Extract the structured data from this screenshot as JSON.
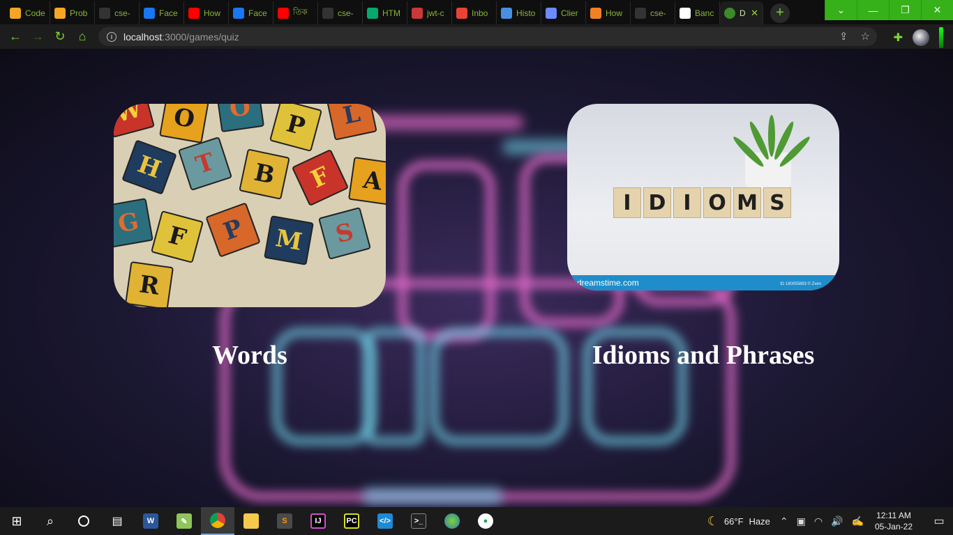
{
  "browser": {
    "tabs": [
      {
        "label": "Code",
        "icon": "bar-chart-icon",
        "color": "#f5a623"
      },
      {
        "label": "Prob",
        "icon": "bar-chart-icon",
        "color": "#f5a623"
      },
      {
        "label": "cse-",
        "icon": "github-icon",
        "color": "#333333"
      },
      {
        "label": "Face",
        "icon": "facebook-icon",
        "color": "#1877f2"
      },
      {
        "label": "How",
        "icon": "youtube-icon",
        "color": "#ff0000"
      },
      {
        "label": "Face",
        "icon": "facebook-icon",
        "color": "#1877f2"
      },
      {
        "label": "তিক",
        "icon": "youtube-icon",
        "color": "#ff0000"
      },
      {
        "label": "cse-",
        "icon": "github-icon",
        "color": "#333333"
      },
      {
        "label": "HTM",
        "icon": "w3-icon",
        "color": "#04aa6d"
      },
      {
        "label": "jwt-c",
        "icon": "npm-icon",
        "color": "#cb3837"
      },
      {
        "label": "Inbo",
        "icon": "gmail-icon",
        "color": "#ea4335"
      },
      {
        "label": "Histo",
        "icon": "history-icon",
        "color": "#4a90e2"
      },
      {
        "label": "Clier",
        "icon": "api-icon",
        "color": "#6b8cff"
      },
      {
        "label": "How",
        "icon": "stackoverflow-icon",
        "color": "#f48024"
      },
      {
        "label": "cse-",
        "icon": "github-icon",
        "color": "#333333"
      },
      {
        "label": "Banc",
        "icon": "wikipedia-icon",
        "color": "#ffffff"
      }
    ],
    "active_tab": {
      "label": "D",
      "icon": "globe-icon"
    },
    "new_tab": "+",
    "window": {
      "minimize": "—",
      "maximize": "❐",
      "close": "✕",
      "collapse": "⌄"
    },
    "url_host": "localhost",
    "url_path": ":3000/games/quiz"
  },
  "page": {
    "cards": [
      {
        "title": "Words",
        "image": "alphabet-tiles-image"
      },
      {
        "title": "Idioms and Phrases",
        "image": "idioms-blocks-image"
      }
    ],
    "words_tiles": [
      "W",
      "O",
      "O",
      "P",
      "L",
      "H",
      "T",
      "B",
      "F",
      "A",
      "G",
      "F",
      "P",
      "M",
      "S",
      "R"
    ],
    "idioms_letters": [
      "I",
      "D",
      "I",
      "O",
      "M",
      "S"
    ],
    "idioms_watermark": "dreamstime.com",
    "idioms_watermark_id": "ID 180055883 © Zven"
  },
  "taskbar": {
    "weather_temp": "66°F",
    "weather_desc": "Haze",
    "time": "12:11 AM",
    "date": "05-Jan-22"
  },
  "colors": {
    "accent_green": "#37b11a",
    "tab_text": "#8ab53a"
  }
}
